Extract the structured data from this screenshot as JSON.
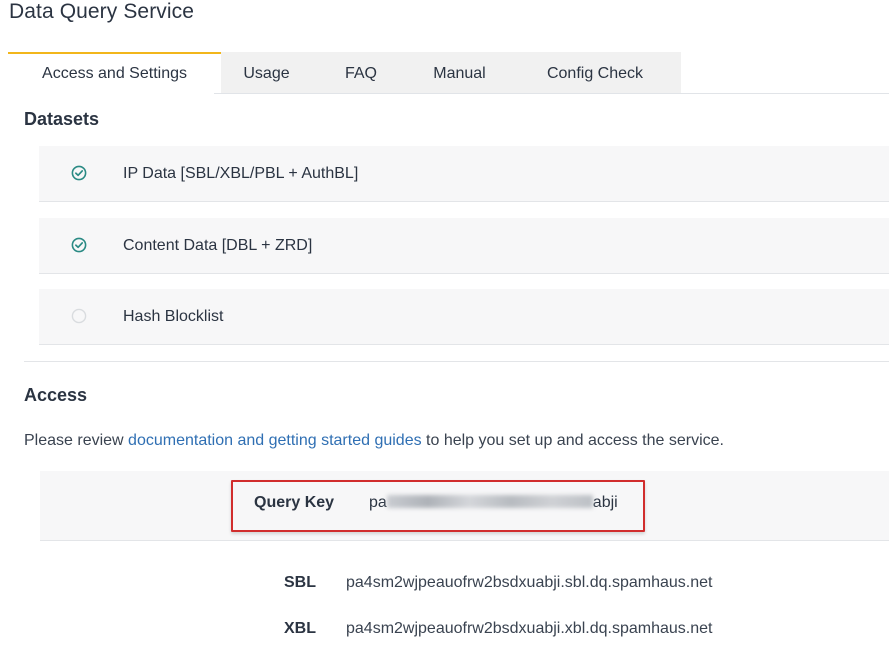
{
  "app": {
    "title": "Data Query Service"
  },
  "tabs": [
    {
      "label": "Access and Settings",
      "active": true
    },
    {
      "label": "Usage",
      "active": false
    },
    {
      "label": "FAQ",
      "active": false
    },
    {
      "label": "Manual",
      "active": false
    },
    {
      "label": "Config Check",
      "active": false
    }
  ],
  "datasets": {
    "heading": "Datasets",
    "items": [
      {
        "label": "IP Data [SBL/XBL/PBL + AuthBL]",
        "enabled": true
      },
      {
        "label": "Content Data [DBL + ZRD]",
        "enabled": true
      },
      {
        "label": "Hash Blocklist",
        "enabled": false
      }
    ]
  },
  "access": {
    "heading": "Access",
    "intro_before": "Please review ",
    "intro_link": "documentation and getting started guides",
    "intro_after": " to help you set up and access the service.",
    "query_key_label": "Query Key",
    "query_key_prefix": "pa",
    "query_key_suffix": "abji",
    "zones": [
      {
        "label": "SBL",
        "value": "pa4sm2wjpeauofrw2bsdxuabji.sbl.dq.spamhaus.net"
      },
      {
        "label": "XBL",
        "value": "pa4sm2wjpeauofrw2bsdxuabji.xbl.dq.spamhaus.net"
      }
    ]
  },
  "colors": {
    "active_tab_accent": "#f2b61b",
    "check_enabled": "#2a8a84",
    "check_disabled": "#d9dcdf",
    "link": "#2f6fb3",
    "highlight": "#d12d2d"
  },
  "icons": {
    "enabled": "check-circle-icon",
    "disabled": "empty-circle-icon"
  }
}
